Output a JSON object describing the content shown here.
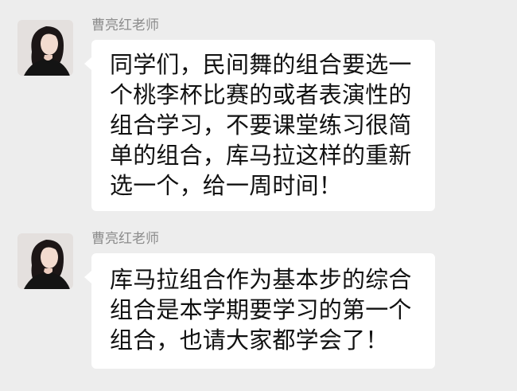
{
  "theme": {
    "background": "#ededed",
    "bubble_color": "#ffffff",
    "name_color": "#8c8c8c",
    "text_color": "#111111"
  },
  "messages": [
    {
      "sender": "曹亮红老师",
      "avatar_icon": "avatar",
      "lines": [
        "同学们，民间舞的组合要选一",
        "个桃李杯比赛的或者表演性的",
        "组合学习，不要课堂练习很简",
        "单的组合，库马拉这样的重新",
        "选一个，给一周时间！"
      ]
    },
    {
      "sender": "曹亮红老师",
      "avatar_icon": "avatar",
      "lines": [
        "库马拉组合作为基本步的综合",
        "组合是本学期要学习的第一个",
        "组合，也请大家都学会了！"
      ]
    }
  ]
}
